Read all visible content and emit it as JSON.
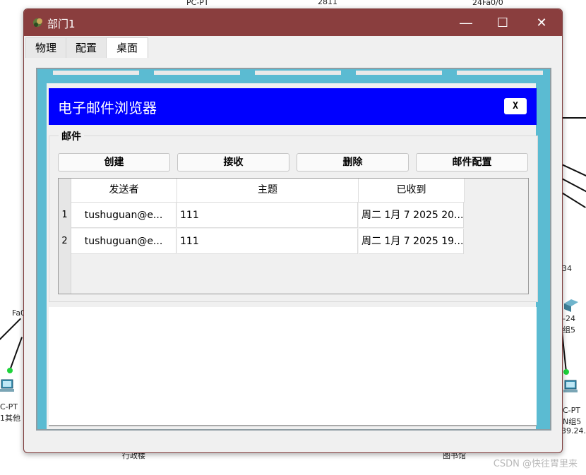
{
  "background": {
    "labels": [
      "PC-PT",
      "2811",
      "24Fa0/0",
      "Fa0",
      "C-PT",
      "1其他",
      "-24",
      "组5",
      "C-PT",
      "N组5",
      "39.24.",
      "行政楼",
      "图书馆",
      "34"
    ],
    "watermark": "CSDN @快往胃里来"
  },
  "window": {
    "title": "部门1",
    "controls": {
      "minimize": "—",
      "maximize": "☐",
      "close": "✕"
    },
    "tabs": [
      "物理",
      "配置",
      "桌面"
    ],
    "active_tab": "桌面"
  },
  "app": {
    "title": "电子邮件浏览器",
    "close_label": "X",
    "group_title": "邮件",
    "buttons": {
      "create": "创建",
      "receive": "接收",
      "delete": "删除",
      "config": "邮件配置"
    },
    "table": {
      "headers": [
        "发送者",
        "主题",
        "已收到"
      ],
      "rows": [
        {
          "num": "1",
          "sender": "tushuguan@e...",
          "subject": "111",
          "received": "周二 1月 7 2025 20..."
        },
        {
          "num": "2",
          "sender": "tushuguan@e...",
          "subject": "111",
          "received": "周二 1月 7 2025 19..."
        }
      ]
    }
  },
  "colors": {
    "titlebar": "#8a3e3e",
    "app_header": "#0000ff",
    "desktop": "#5bbbd2"
  }
}
